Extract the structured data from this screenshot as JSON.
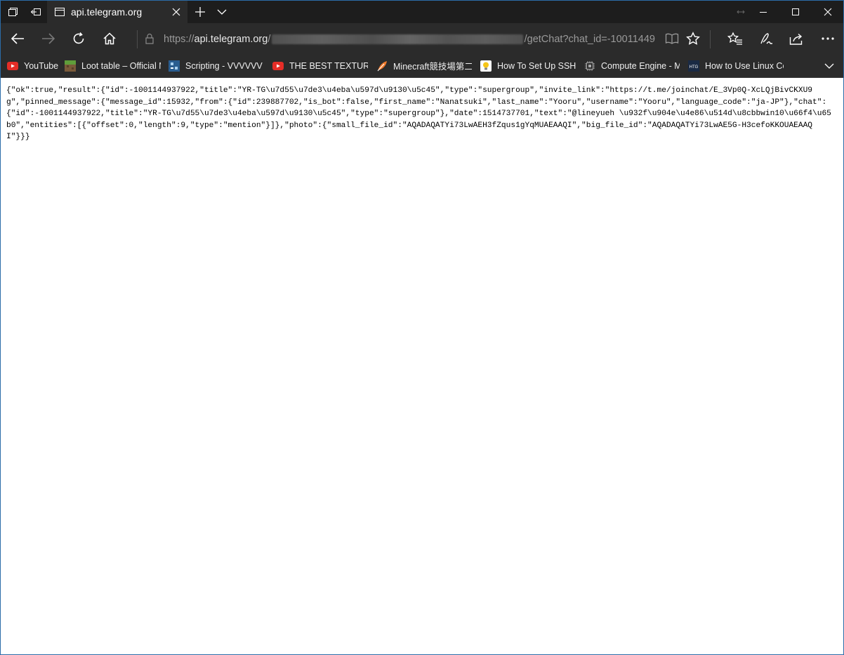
{
  "tab": {
    "title": "api.telegram.org"
  },
  "address": {
    "prefix": "https://",
    "host": "api.telegram.org",
    "slash": "/",
    "suffix": "/getChat?chat_id=-10011449"
  },
  "favorites": [
    {
      "label": "YouTube",
      "icon": "youtube-icon",
      "color": "#e52d27"
    },
    {
      "label": "Loot table – Official M",
      "icon": "minecraft-grass-icon",
      "color": "#6b8e3a"
    },
    {
      "label": "Scripting - VVVVVV W",
      "icon": "wiki-icon",
      "color": "#2a5d8f"
    },
    {
      "label": "THE BEST TEXTURE PA",
      "icon": "youtube-icon",
      "color": "#e52d27"
    },
    {
      "label": "Minecraft競技場第二",
      "icon": "feather-icon",
      "color": "#f07a2b"
    },
    {
      "label": "How To Set Up SSH W",
      "icon": "lightbulb-icon",
      "color": "#f5c518"
    },
    {
      "label": "Compute Engine - My",
      "icon": "chip-icon",
      "color": "#9a9a9a"
    },
    {
      "label": "How to Use Linux Co",
      "icon": "htg-icon",
      "color": "#1a2a44"
    }
  ],
  "page": {
    "json_text": "{\"ok\":true,\"result\":{\"id\":-1001144937922,\"title\":\"YR-TG\\u7d55\\u7de3\\u4eba\\u597d\\u9130\\u5c45\",\"type\":\"supergroup\",\"invite_link\":\"https://t.me/joinchat/E_3Vp0Q-XcLQjBivCKXU9g\",\"pinned_message\":{\"message_id\":15932,\"from\":{\"id\":239887702,\"is_bot\":false,\"first_name\":\"Nanatsuki\",\"last_name\":\"Yooru\",\"username\":\"Yooru\",\"language_code\":\"ja-JP\"},\"chat\":{\"id\":-1001144937922,\"title\":\"YR-TG\\u7d55\\u7de3\\u4eba\\u597d\\u9130\\u5c45\",\"type\":\"supergroup\"},\"date\":1514737701,\"text\":\"@lineyueh \\u932f\\u904e\\u4e86\\u514d\\u8cbbwin10\\u66f4\\u65b0\",\"entities\":[{\"offset\":0,\"length\":9,\"type\":\"mention\"}]},\"photo\":{\"small_file_id\":\"AQADAQATYi73LwAEH3fZqus1gYqMUAEAAQI\",\"big_file_id\":\"AQADAQATYi73LwAE5G-H3cefoKKOUAEAAQI\"}}}"
  }
}
